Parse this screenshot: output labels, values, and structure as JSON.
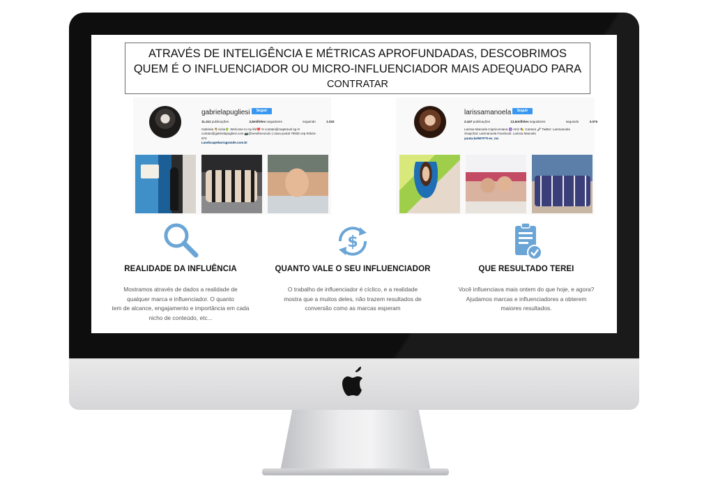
{
  "headline": {
    "line1": "ATRAVÉS DE INTELIGÊNCIA E MÉTRICAS APROFUNDADAS, DESCOBRIMOS",
    "line2": "QUEM É O INFLUENCIADOR OU MICRO-INFLUENCIADOR MAIS ADEQUADO PARA",
    "line3": "CONTRATAR"
  },
  "profiles": [
    {
      "username": "gabrielapugliesi",
      "follow_label": "Seguir",
      "posts": "11.411",
      "posts_label": "publicações",
      "followers": "3,8milhões",
      "followers_label": "seguidores",
      "following_label": "seguindo",
      "following": "1.033",
      "bio_line1": "Gabriela 🌴ciclar🌵 Welcome to my life❤️ ✉ contato@maptravel.sg ✉",
      "bio_line2": "contato@gabrielapugliesi.com 📷@vendimeusolo | caixa postal 79936 cep-04544-",
      "bio_line3": "970",
      "link": "Landscapebarragrande.com.br"
    },
    {
      "username": "larissamanoela",
      "follow_label": "Seguir",
      "posts": "2.447",
      "posts_label": "publicações",
      "followers": "13,6milhões",
      "followers_label": "seguidores",
      "following_label": "seguindo",
      "following": "3.076",
      "bio_line1": "Larissa Manoela Capricorniana ♑ Atriz 🎭 Cantora 🎤 Twitter: Larimanoela",
      "bio_line2": "Snapchat: Larimanoela Facebook: Larissa Manoela",
      "link": "youtu.be/WYFTI-ev_mc"
    }
  ],
  "features": [
    {
      "icon": "magnifier-icon",
      "title": "REALIDADE DA INFLUÊNCIA",
      "text": "Mostramos através de dados a realidade de\nqualquer marca e influenciador. O quanto\ntem de alcance, engajamento e importância em cada\nnicho de conteúdo, etc..."
    },
    {
      "icon": "dollar-cycle-icon",
      "title": "QUANTO VALE O SEU INFLUENCIADOR",
      "text": "O trabalho de influenciador é cíclico, e a realidade\nmostra que a muitos deles, não trazem resultados de\nconversão como as marcas esperam"
    },
    {
      "icon": "clipboard-check-icon",
      "title": "QUE RESULTADO TEREI",
      "text": "Você influenciava mais ontem do que hoje, e agora?\nAjudamos marcas e  influenciadores a obterem\nmaiores resultados."
    }
  ],
  "colors": {
    "accent_icon": "#6aa5d6",
    "instagram_blue": "#3897f0",
    "bezel": "#0e0e0f"
  }
}
